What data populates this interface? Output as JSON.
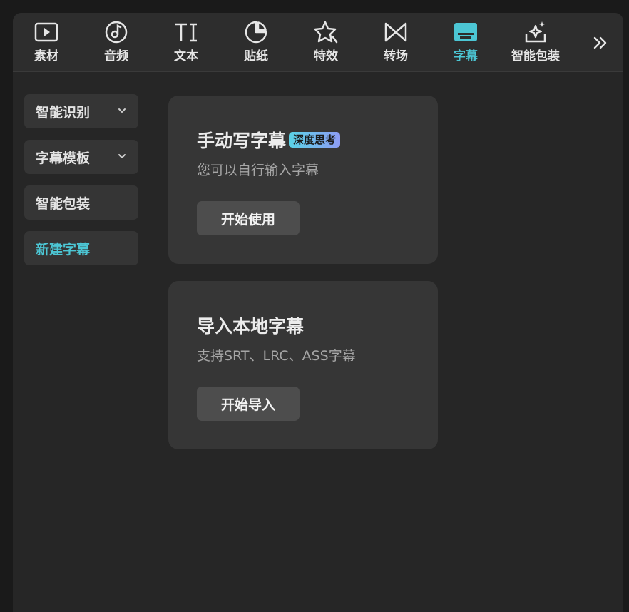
{
  "toolbar": {
    "items": [
      {
        "label": "素材",
        "icon": "media-icon"
      },
      {
        "label": "音频",
        "icon": "audio-icon"
      },
      {
        "label": "文本",
        "icon": "text-icon"
      },
      {
        "label": "贴纸",
        "icon": "sticker-icon"
      },
      {
        "label": "特效",
        "icon": "effects-icon"
      },
      {
        "label": "转场",
        "icon": "transition-icon"
      },
      {
        "label": "字幕",
        "icon": "subtitle-icon",
        "active": true
      },
      {
        "label": "智能包装",
        "icon": "smart-package-icon"
      }
    ],
    "more_icon": "double-chevron-right-icon"
  },
  "sidebar": {
    "items": [
      {
        "label": "智能识别",
        "has_dropdown": true
      },
      {
        "label": "字幕模板",
        "has_dropdown": true
      },
      {
        "label": "智能包装",
        "has_dropdown": false
      },
      {
        "label": "新建字幕",
        "has_dropdown": false,
        "active": true
      }
    ]
  },
  "cards": [
    {
      "title": "手动写字幕",
      "badge": "深度思考",
      "description": "您可以自行输入字幕",
      "button": "开始使用"
    },
    {
      "title": "导入本地字幕",
      "description": "支持SRT、LRC、ASS字幕",
      "button": "开始导入"
    }
  ],
  "colors": {
    "accent": "#4cc6d4",
    "panel_bg": "#262626",
    "card_bg": "#363636",
    "button_bg": "#4d4d4d",
    "badge_gradient_start": "#5ad3e6",
    "badge_gradient_end": "#8e9cf5"
  }
}
